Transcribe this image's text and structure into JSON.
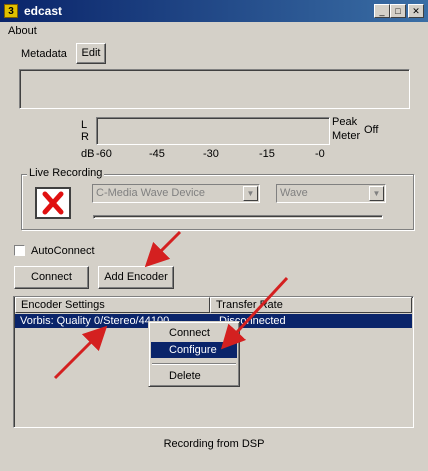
{
  "window": {
    "icon_glyph": "3",
    "title": "edcast",
    "minimize_glyph": "_",
    "maximize_glyph": "□",
    "close_glyph": "✕"
  },
  "menu": {
    "about": "About"
  },
  "metadata": {
    "label": "Metadata",
    "edit_button": "Edit",
    "value": ""
  },
  "meter": {
    "l_label": "L",
    "r_label": "R",
    "peak_label": "Peak",
    "meter_label": "Meter",
    "state": "Off",
    "db_label": "dB",
    "ticks": [
      "-60",
      "-45",
      "-30",
      "-15",
      "-0"
    ]
  },
  "live_recording": {
    "group_label": "Live Recording",
    "device": "C-Media Wave Device",
    "source": "Wave",
    "icon": "red-x-icon"
  },
  "autoconnect": {
    "label": "AutoConnect",
    "checked": false
  },
  "buttons": {
    "connect": "Connect",
    "add_encoder": "Add Encoder"
  },
  "encoder_table": {
    "columns": [
      "Encoder Settings",
      "Transfer Rate"
    ],
    "rows": [
      {
        "settings": "Vorbis: Quality 0/Stereo/44100",
        "rate": "Disconnected"
      }
    ]
  },
  "context_menu": {
    "items": [
      "Connect",
      "Configure",
      "Delete"
    ],
    "highlighted": "Configure"
  },
  "status": {
    "text": "Recording from DSP"
  },
  "colors": {
    "face": "#d4d0c8",
    "selection": "#0a246a",
    "annotation_arrow": "#d42020"
  }
}
